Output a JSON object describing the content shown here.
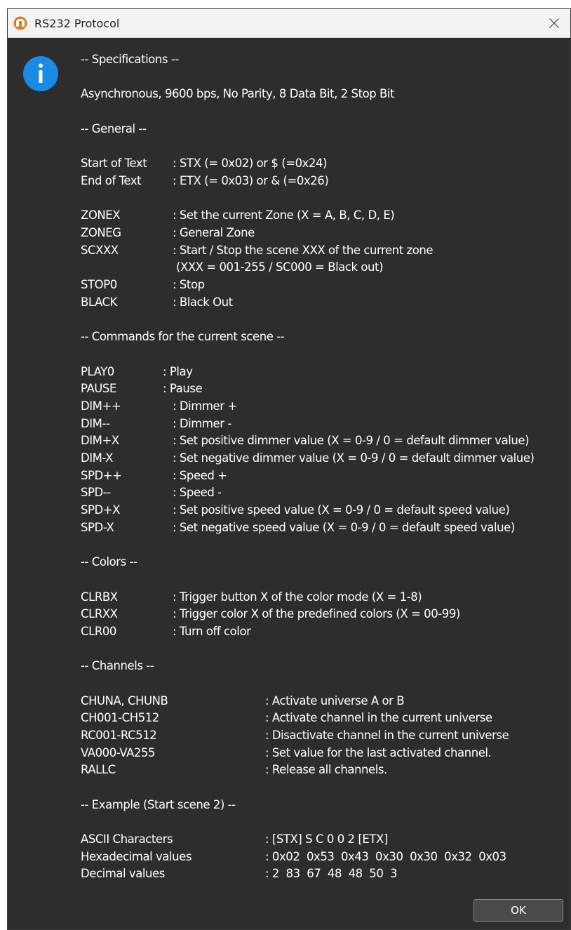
{
  "window": {
    "title": "RS232 Protocol",
    "app_icon": "orange-app-logo-icon",
    "close_icon": "close-icon",
    "info_icon": "info-icon"
  },
  "content": {
    "specifications": {
      "heading": "-- Specifications --",
      "text": "Asynchronous, 9600 bps, No Parity, 8 Data Bit, 2 Stop Bit"
    },
    "general": {
      "heading": "-- General --",
      "framing": [
        {
          "cmd": "Start of Text",
          "desc": ": STX (= 0x02) or $ (=0x24)"
        },
        {
          "cmd": "End of Text",
          "desc": ": ETX (= 0x03) or & (=0x26)"
        }
      ],
      "zones": [
        {
          "cmd": "ZONEX",
          "desc": ": Set the current Zone (X = A, B, C, D, E)"
        },
        {
          "cmd": "ZONEG",
          "desc": ": General Zone"
        },
        {
          "cmd": "SCXXX",
          "desc": ": Start / Stop the scene XXX of the current zone"
        },
        {
          "cmd": "",
          "desc": " (XXX = 001-255 / SC000 = Black out)"
        },
        {
          "cmd": "STOP0",
          "desc": ": Stop"
        },
        {
          "cmd": "BLACK",
          "desc": ": Black Out"
        }
      ]
    },
    "scene_commands": {
      "heading": "-- Commands for the current scene --",
      "items": [
        {
          "cmd": "PLAY0",
          "desc": ": Play"
        },
        {
          "cmd": "PAUSE",
          "desc": ": Pause"
        },
        {
          "cmd": "DIM++",
          "desc": ": Dimmer +"
        },
        {
          "cmd": "DIM--",
          "desc": ": Dimmer -"
        },
        {
          "cmd": "DIM+X",
          "desc": ": Set positive dimmer value (X = 0-9 / 0 = default dimmer value)"
        },
        {
          "cmd": "DIM-X",
          "desc": ": Set negative dimmer value (X = 0-9 / 0 = default dimmer value)"
        },
        {
          "cmd": "SPD++",
          "desc": ": Speed +"
        },
        {
          "cmd": "SPD--",
          "desc": ": Speed -"
        },
        {
          "cmd": "SPD+X",
          "desc": ": Set positive speed value (X = 0-9 / 0 = default speed value)"
        },
        {
          "cmd": "SPD-X",
          "desc": ": Set negative speed value (X = 0-9 / 0 = default speed value)"
        }
      ]
    },
    "colors": {
      "heading": "-- Colors --",
      "items": [
        {
          "cmd": "CLRBX",
          "desc": ": Trigger button X of the color mode (X = 1-8)"
        },
        {
          "cmd": "CLRXX",
          "desc": ": Trigger color X of the predefined colors (X = 00-99)"
        },
        {
          "cmd": "CLR00",
          "desc": ": Turn off color"
        }
      ]
    },
    "channels": {
      "heading": "-- Channels --",
      "items": [
        {
          "cmd": "CHUNA, CHUNB",
          "desc": ": Activate universe A or B"
        },
        {
          "cmd": "CH001-CH512",
          "desc": ": Activate channel in the current universe"
        },
        {
          "cmd": "RC001-RC512",
          "desc": ": Disactivate channel in the current universe"
        },
        {
          "cmd": "VA000-VA255",
          "desc": ": Set value for the last activated channel."
        },
        {
          "cmd": "RALLC",
          "desc": ": Release all channels."
        }
      ]
    },
    "example": {
      "heading": "-- Example (Start scene 2) --",
      "items": [
        {
          "cmd": "ASCII Characters",
          "desc": ": [STX] S C 0 0 2 [ETX]"
        },
        {
          "cmd": "Hexadecimal values",
          "desc": ": 0x02  0x53  0x43  0x30  0x30  0x32  0x03"
        },
        {
          "cmd": "Decimal values",
          "desc": ": 2  83  67  48  48  50  3"
        }
      ]
    }
  },
  "buttons": {
    "ok_label": "OK"
  },
  "colors": {
    "dialog_bg": "#2d2d2d",
    "titlebar_bg": "#f3f3f3",
    "info_blue": "#1a8ae5",
    "app_icon_orange": "#e07a1f",
    "text": "#ffffff"
  }
}
